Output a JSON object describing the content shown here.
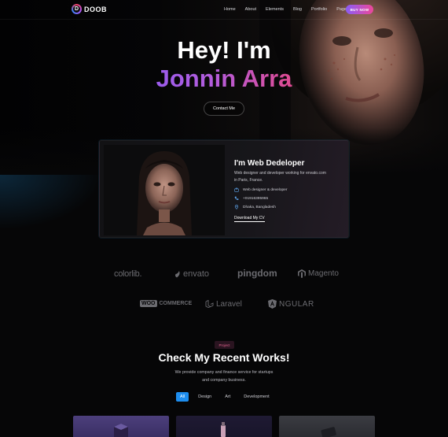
{
  "nav": {
    "logo_letter": "D",
    "logo_text": "DOOB",
    "items": [
      "Home",
      "About",
      "Elements",
      "Blog",
      "Portfolio",
      "Pages"
    ],
    "buy_label": "BUY NOW"
  },
  "hero": {
    "greeting": "Hey! I'm",
    "name": "Jonnin Arra",
    "contact_label": "Contact Me"
  },
  "card": {
    "title": "I'm Web Dedeloper",
    "description": "Web designer and developer working for envato.com in Paris, France.",
    "role": "Web designer & developer",
    "phone": "+01916395965",
    "location": "Dhaka, Bangladesh",
    "download_label": "Download My CV"
  },
  "brands": {
    "colorlib": "colorlib.",
    "envato": "envato",
    "pingdom": "pingdom",
    "magento": "Magento",
    "woo_left": "WOO",
    "woo_right": "COMMERCE",
    "laravel": "Laravel",
    "angular": "NGULAR"
  },
  "works": {
    "tag": "Project",
    "title": "Check My Recent Works!",
    "subtitle": "We provide company and finance service for startups and company business.",
    "filters": [
      "All",
      "Design",
      "Art",
      "Development"
    ],
    "active_filter": "All"
  },
  "colors": {
    "accent_gradient_start": "#8b5cf6",
    "accent_gradient_end": "#f4436e",
    "filter_active": "#1d8dee",
    "background": "#060607"
  }
}
